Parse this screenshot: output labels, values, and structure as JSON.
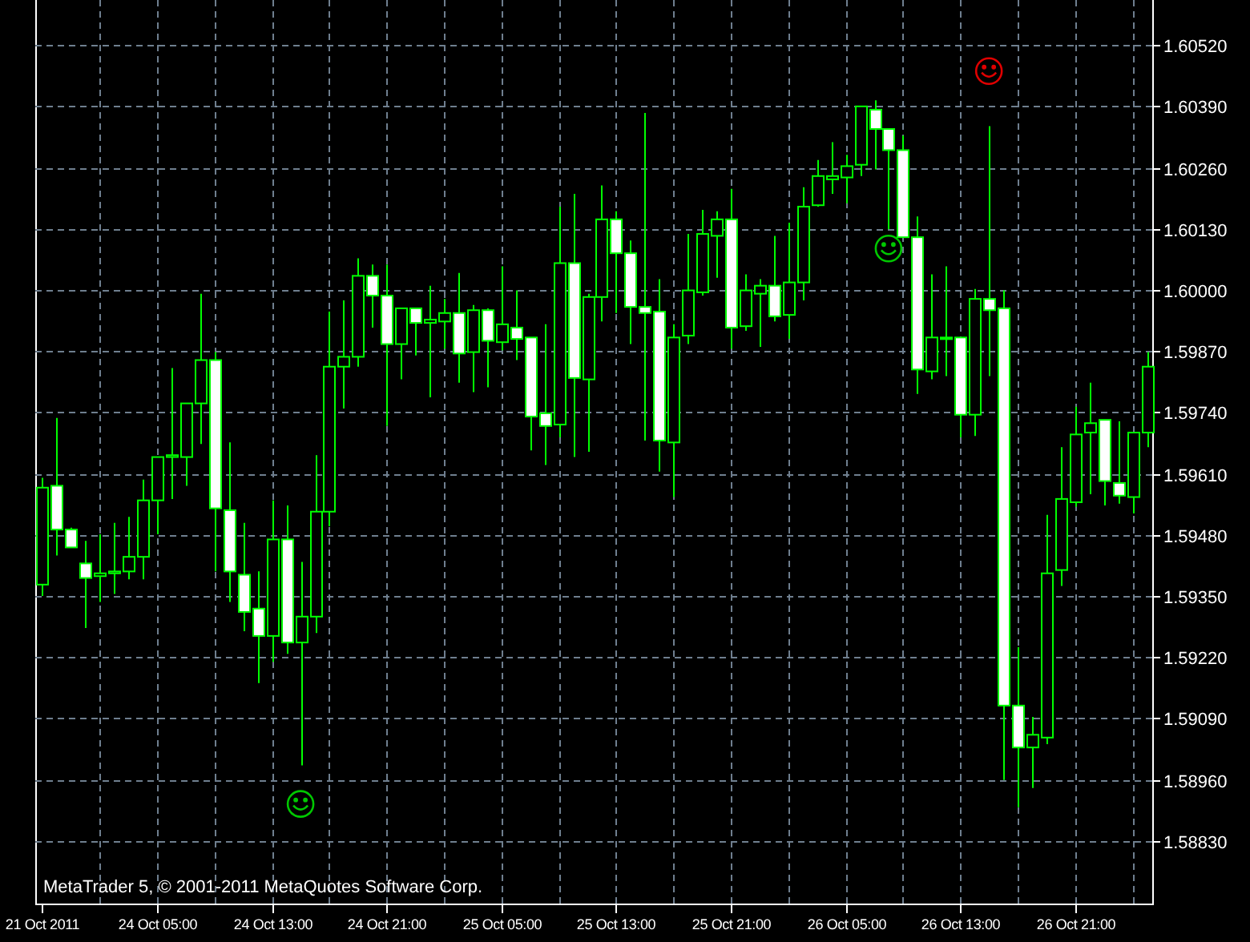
{
  "chart_data": {
    "type": "candlestick",
    "categories": [
      "21 Oct 2011",
      null,
      null,
      null,
      null,
      null,
      null,
      null,
      "24 Oct 05:00",
      null,
      null,
      null,
      null,
      null,
      null,
      null,
      "24 Oct 13:00",
      null,
      null,
      null,
      null,
      null,
      null,
      null,
      "24 Oct 21:00",
      null,
      null,
      null,
      null,
      null,
      null,
      null,
      "25 Oct 05:00",
      null,
      null,
      null,
      null,
      null,
      null,
      null,
      "25 Oct 13:00",
      null,
      null,
      null,
      null,
      null,
      null,
      null,
      "25 Oct 21:00",
      null,
      null,
      null,
      null,
      null,
      null,
      null,
      "26 Oct 05:00",
      null,
      null,
      null,
      null,
      null,
      null,
      null,
      "26 Oct 13:00",
      null,
      null,
      null,
      null,
      null,
      null,
      null,
      "26 Oct 21:00",
      null,
      null,
      null,
      null,
      null
    ],
    "ohlc": [
      [
        1.59374,
        1.59601,
        1.5935,
        1.5958
      ],
      [
        1.59584,
        1.59728,
        1.59436,
        1.59491
      ],
      [
        1.59491,
        1.59495,
        1.59453,
        1.59453
      ],
      [
        1.59419,
        1.59467,
        1.59282,
        1.59388
      ],
      [
        1.59392,
        1.59481,
        1.59337,
        1.59398
      ],
      [
        1.59398,
        1.59505,
        1.59354,
        1.59402
      ],
      [
        1.59402,
        1.59518,
        1.59385,
        1.59433
      ],
      [
        1.59433,
        1.59597,
        1.59385,
        1.59553
      ],
      [
        1.59553,
        1.59645,
        1.59481,
        1.59645
      ],
      [
        1.59645,
        1.59834,
        1.59556,
        1.59649
      ],
      [
        1.59645,
        1.59759,
        1.59584,
        1.59759
      ],
      [
        1.59759,
        1.59992,
        1.59673,
        1.59851
      ],
      [
        1.59851,
        1.59868,
        1.59402,
        1.59536
      ],
      [
        1.59532,
        1.59676,
        1.59337,
        1.59402
      ],
      [
        1.59395,
        1.59505,
        1.59275,
        1.59316
      ],
      [
        1.59323,
        1.59402,
        1.59165,
        1.59265
      ],
      [
        1.59265,
        1.59553,
        1.5921,
        1.5947
      ],
      [
        1.5947,
        1.59542,
        1.59227,
        1.59251
      ],
      [
        1.59251,
        1.59422,
        1.5899,
        1.59306
      ],
      [
        1.59306,
        1.59649,
        1.59271,
        1.59529
      ],
      [
        1.59529,
        1.59954,
        1.59498,
        1.59837
      ],
      [
        1.59837,
        1.59978,
        1.59748,
        1.59858
      ],
      [
        1.59858,
        1.60067,
        1.59837,
        1.6003
      ],
      [
        1.6003,
        1.60054,
        1.5992,
        1.59988
      ],
      [
        1.59988,
        1.60054,
        1.59711,
        1.59885
      ],
      [
        1.59885,
        1.59961,
        1.5981,
        1.59961
      ],
      [
        1.59961,
        1.59961,
        1.59861,
        1.5993
      ],
      [
        1.5993,
        1.60009,
        1.59772,
        1.59937
      ],
      [
        1.59933,
        1.59981,
        1.59875,
        1.59951
      ],
      [
        1.59951,
        1.60036,
        1.59803,
        1.59865
      ],
      [
        1.59868,
        1.59968,
        1.59783,
        1.59957
      ],
      [
        1.59957,
        1.59961,
        1.59793,
        1.59892
      ],
      [
        1.59889,
        1.6005,
        1.59872,
        1.59927
      ],
      [
        1.5992,
        1.59999,
        1.59851,
        1.59896
      ],
      [
        1.59899,
        1.59899,
        1.59659,
        1.59731
      ],
      [
        1.59738,
        1.59927,
        1.59628,
        1.59711
      ],
      [
        1.59714,
        1.60177,
        1.59687,
        1.60057
      ],
      [
        1.60057,
        1.60204,
        1.59645,
        1.59813
      ],
      [
        1.5981,
        1.59992,
        1.59656,
        1.59985
      ],
      [
        1.59985,
        1.60222,
        1.59933,
        1.6015
      ],
      [
        1.6015,
        1.60167,
        1.59951,
        1.60078
      ],
      [
        1.60078,
        1.60105,
        1.59885,
        1.59964
      ],
      [
        1.59964,
        1.60376,
        1.5968,
        1.59951
      ],
      [
        1.59954,
        1.60023,
        1.59614,
        1.5968
      ],
      [
        1.59676,
        1.59927,
        1.5956,
        1.59899
      ],
      [
        1.59903,
        1.60119,
        1.59885,
        1.59999
      ],
      [
        1.59995,
        1.6017,
        1.59988,
        1.60119
      ],
      [
        1.60115,
        1.60167,
        1.60026,
        1.6015
      ],
      [
        1.6015,
        1.60215,
        1.59875,
        1.5992
      ],
      [
        1.59923,
        1.60033,
        1.59913,
        1.59999
      ],
      [
        1.59992,
        1.60023,
        1.59879,
        1.60009
      ],
      [
        1.60009,
        1.60115,
        1.59933,
        1.59944
      ],
      [
        1.59947,
        1.60143,
        1.59896,
        1.60016
      ],
      [
        1.60016,
        1.60218,
        1.59978,
        1.60177
      ],
      [
        1.6018,
        1.60276,
        1.60177,
        1.60242
      ],
      [
        1.60235,
        1.60314,
        1.60204,
        1.60242
      ],
      [
        1.60239,
        1.60287,
        1.60184,
        1.60263
      ],
      [
        1.60266,
        1.6039,
        1.60242,
        1.6039
      ],
      [
        1.60383,
        1.60403,
        1.60256,
        1.60342
      ],
      [
        1.60342,
        1.60342,
        1.60129,
        1.60297
      ],
      [
        1.60297,
        1.60328,
        1.60112,
        1.60112
      ],
      [
        1.60112,
        1.60156,
        1.59779,
        1.59831
      ],
      [
        1.59827,
        1.60033,
        1.5981,
        1.59899
      ],
      [
        1.59896,
        1.6005,
        1.59817,
        1.59899
      ],
      [
        1.59899,
        1.59899,
        1.59687,
        1.59735
      ],
      [
        1.59735,
        1.60002,
        1.5969,
        1.59981
      ],
      [
        1.59981,
        1.60348,
        1.59817,
        1.59957
      ],
      [
        1.59961,
        1.59999,
        1.58959,
        1.59117
      ],
      [
        1.59117,
        1.59241,
        1.58901,
        1.59028
      ],
      [
        1.59028,
        1.59093,
        1.58942,
        1.59055
      ],
      [
        1.59049,
        1.59522,
        1.59035,
        1.59398
      ],
      [
        1.59405,
        1.59666,
        1.59371,
        1.59556
      ],
      [
        1.59549,
        1.59752,
        1.59539,
        1.59693
      ],
      [
        1.59697,
        1.59803,
        1.59566,
        1.59717
      ],
      [
        1.59724,
        1.59724,
        1.59542,
        1.59594
      ],
      [
        1.5959,
        1.59721,
        1.59546,
        1.59563
      ],
      [
        1.5956,
        1.59697,
        1.59525,
        1.59697
      ],
      [
        1.59697,
        1.59868,
        1.59666,
        1.59837
      ]
    ],
    "grid": true,
    "ylim": [
      1.58693,
      1.60616
    ],
    "yticks": [
      {
        "value": 1.6052,
        "label": "1.60520"
      },
      {
        "value": 1.6039,
        "label": "1.60390"
      },
      {
        "value": 1.6026,
        "label": "1.60260"
      },
      {
        "value": 1.6013,
        "label": "1.60130"
      },
      {
        "value": 1.6,
        "label": "1.60000"
      },
      {
        "value": 1.5987,
        "label": "1.59870"
      },
      {
        "value": 1.5974,
        "label": "1.59740"
      },
      {
        "value": 1.5961,
        "label": "1.59610"
      },
      {
        "value": 1.5948,
        "label": "1.59480"
      },
      {
        "value": 1.5935,
        "label": "1.59350"
      },
      {
        "value": 1.5922,
        "label": "1.59220"
      },
      {
        "value": 1.5909,
        "label": "1.59090"
      },
      {
        "value": 1.5896,
        "label": "1.58960"
      },
      {
        "value": 1.5883,
        "label": "1.58830"
      }
    ]
  },
  "signals": [
    {
      "color": "#00c800"
    },
    {
      "color": "#00c800"
    },
    {
      "color": "#e00000"
    }
  ],
  "copyright": "MetaTrader 5, © 2001-2011 MetaQuotes Software Corp."
}
